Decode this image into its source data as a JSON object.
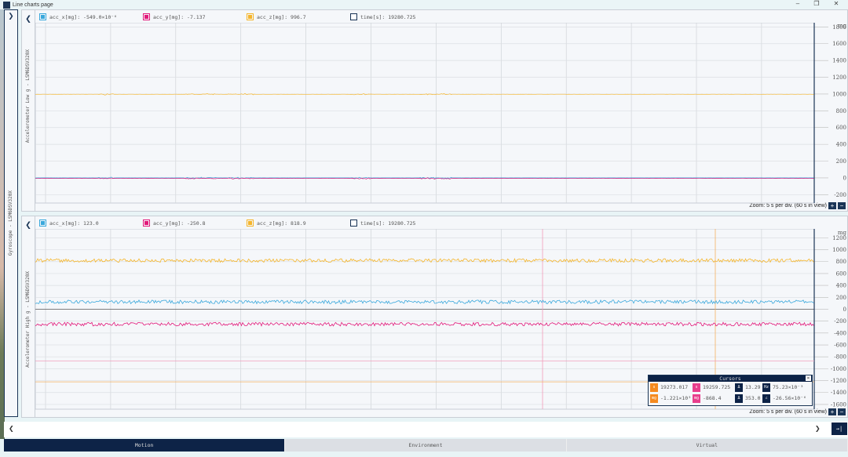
{
  "window": {
    "title": "Line charts page",
    "minimize": "–",
    "restore": "❐",
    "close": "✕"
  },
  "outer_panel": {
    "label": "Gyroscope - LSM6DSV320X",
    "expand": "❯"
  },
  "charts": [
    {
      "title": "Accelerometer Low g - LSM6DSV320X",
      "collapse": "❮",
      "legend": [
        {
          "label": "acc_x[mg]: -549.0×10⁻⁶",
          "color": "#3aa8dc"
        },
        {
          "label": "acc_y[mg]: -7.137",
          "color": "#e2197a"
        },
        {
          "label": "acc_z[mg]: 996.7",
          "color": "#f5b52a"
        },
        {
          "label": "time[s]: 19280.725",
          "color": "#1b3556"
        }
      ],
      "zoom": "Zoom: 5 s per div. (60 s in view)",
      "zoom_in": "+",
      "zoom_out": "−"
    },
    {
      "title": "Accelerometer High g - LSM6DSV320X",
      "collapse": "❮",
      "legend": [
        {
          "label": "acc_x[mg]: 123.0",
          "color": "#3aa8dc"
        },
        {
          "label": "acc_y[mg]: -250.8",
          "color": "#e2197a"
        },
        {
          "label": "acc_z[mg]: 818.9",
          "color": "#f5b52a"
        },
        {
          "label": "time[s]: 19280.725",
          "color": "#1b3556"
        }
      ],
      "zoom": "Zoom: 5 s per div. (60 s in view)",
      "zoom_in": "+",
      "zoom_out": "−"
    }
  ],
  "chart_data": [
    {
      "type": "line",
      "unit": "mg",
      "ylim": [
        -300,
        1850
      ],
      "yticks": [
        1800,
        1600,
        1400,
        1200,
        1000,
        800,
        600,
        400,
        200,
        0,
        -200
      ],
      "x_view_s": 60,
      "x_divs": 12,
      "series": [
        {
          "name": "acc_x",
          "level": 0,
          "noise": 4,
          "color": "#3aa8dc"
        },
        {
          "name": "acc_y",
          "level": -7,
          "noise": 4,
          "color": "#e2197a"
        },
        {
          "name": "acc_z",
          "level": 997,
          "noise": 4,
          "color": "#f5b52a"
        }
      ]
    },
    {
      "type": "line",
      "unit": "mg",
      "ylim": [
        -1680,
        1350
      ],
      "yticks": [
        1200,
        1000,
        800,
        600,
        400,
        200,
        0,
        -200,
        -400,
        -600,
        -800,
        -1000,
        -1200,
        -1400,
        -1600
      ],
      "x_view_s": 60,
      "x_divs": 12,
      "series": [
        {
          "name": "acc_x",
          "level": 123,
          "noise": 30,
          "color": "#3aa8dc"
        },
        {
          "name": "acc_y",
          "level": -251,
          "noise": 30,
          "color": "#e2197a"
        },
        {
          "name": "acc_z",
          "level": 819,
          "noise": 30,
          "color": "#f5b52a"
        }
      ],
      "cursors": {
        "pink_time": 19259.725,
        "orange_time": 19273.017,
        "pink_value": -868.4,
        "orange_value": -1221
      }
    }
  ],
  "cursors_panel": {
    "title": "Cursors",
    "close": "×",
    "rows": [
      [
        {
          "badge": "s",
          "color": "#f58a1f",
          "value": "19273.017"
        },
        {
          "badge": "s",
          "color": "#e83e8c",
          "value": "19259.725"
        },
        {
          "badge": "Δ",
          "color": "#0d2347",
          "value": "13.29"
        },
        {
          "badge": "Hz",
          "color": "#0d2347",
          "value": "75.23×10⁻³"
        }
      ],
      [
        {
          "badge": "mg",
          "color": "#f58a1f",
          "value": "-1.221×10³"
        },
        {
          "badge": "mg",
          "color": "#e83e8c",
          "value": "-868.4"
        },
        {
          "badge": "Δ",
          "color": "#0d2347",
          "value": "353.0"
        },
        {
          "badge": "∠",
          "color": "#0d2347",
          "value": "-26.56×10⁻⁶"
        }
      ]
    ]
  },
  "nav": {
    "prev": "❮",
    "next": "❯",
    "end": "→|"
  },
  "tabs": [
    {
      "label": "Motion",
      "active": true
    },
    {
      "label": "Environment"
    },
    {
      "label": "Virtual"
    }
  ]
}
